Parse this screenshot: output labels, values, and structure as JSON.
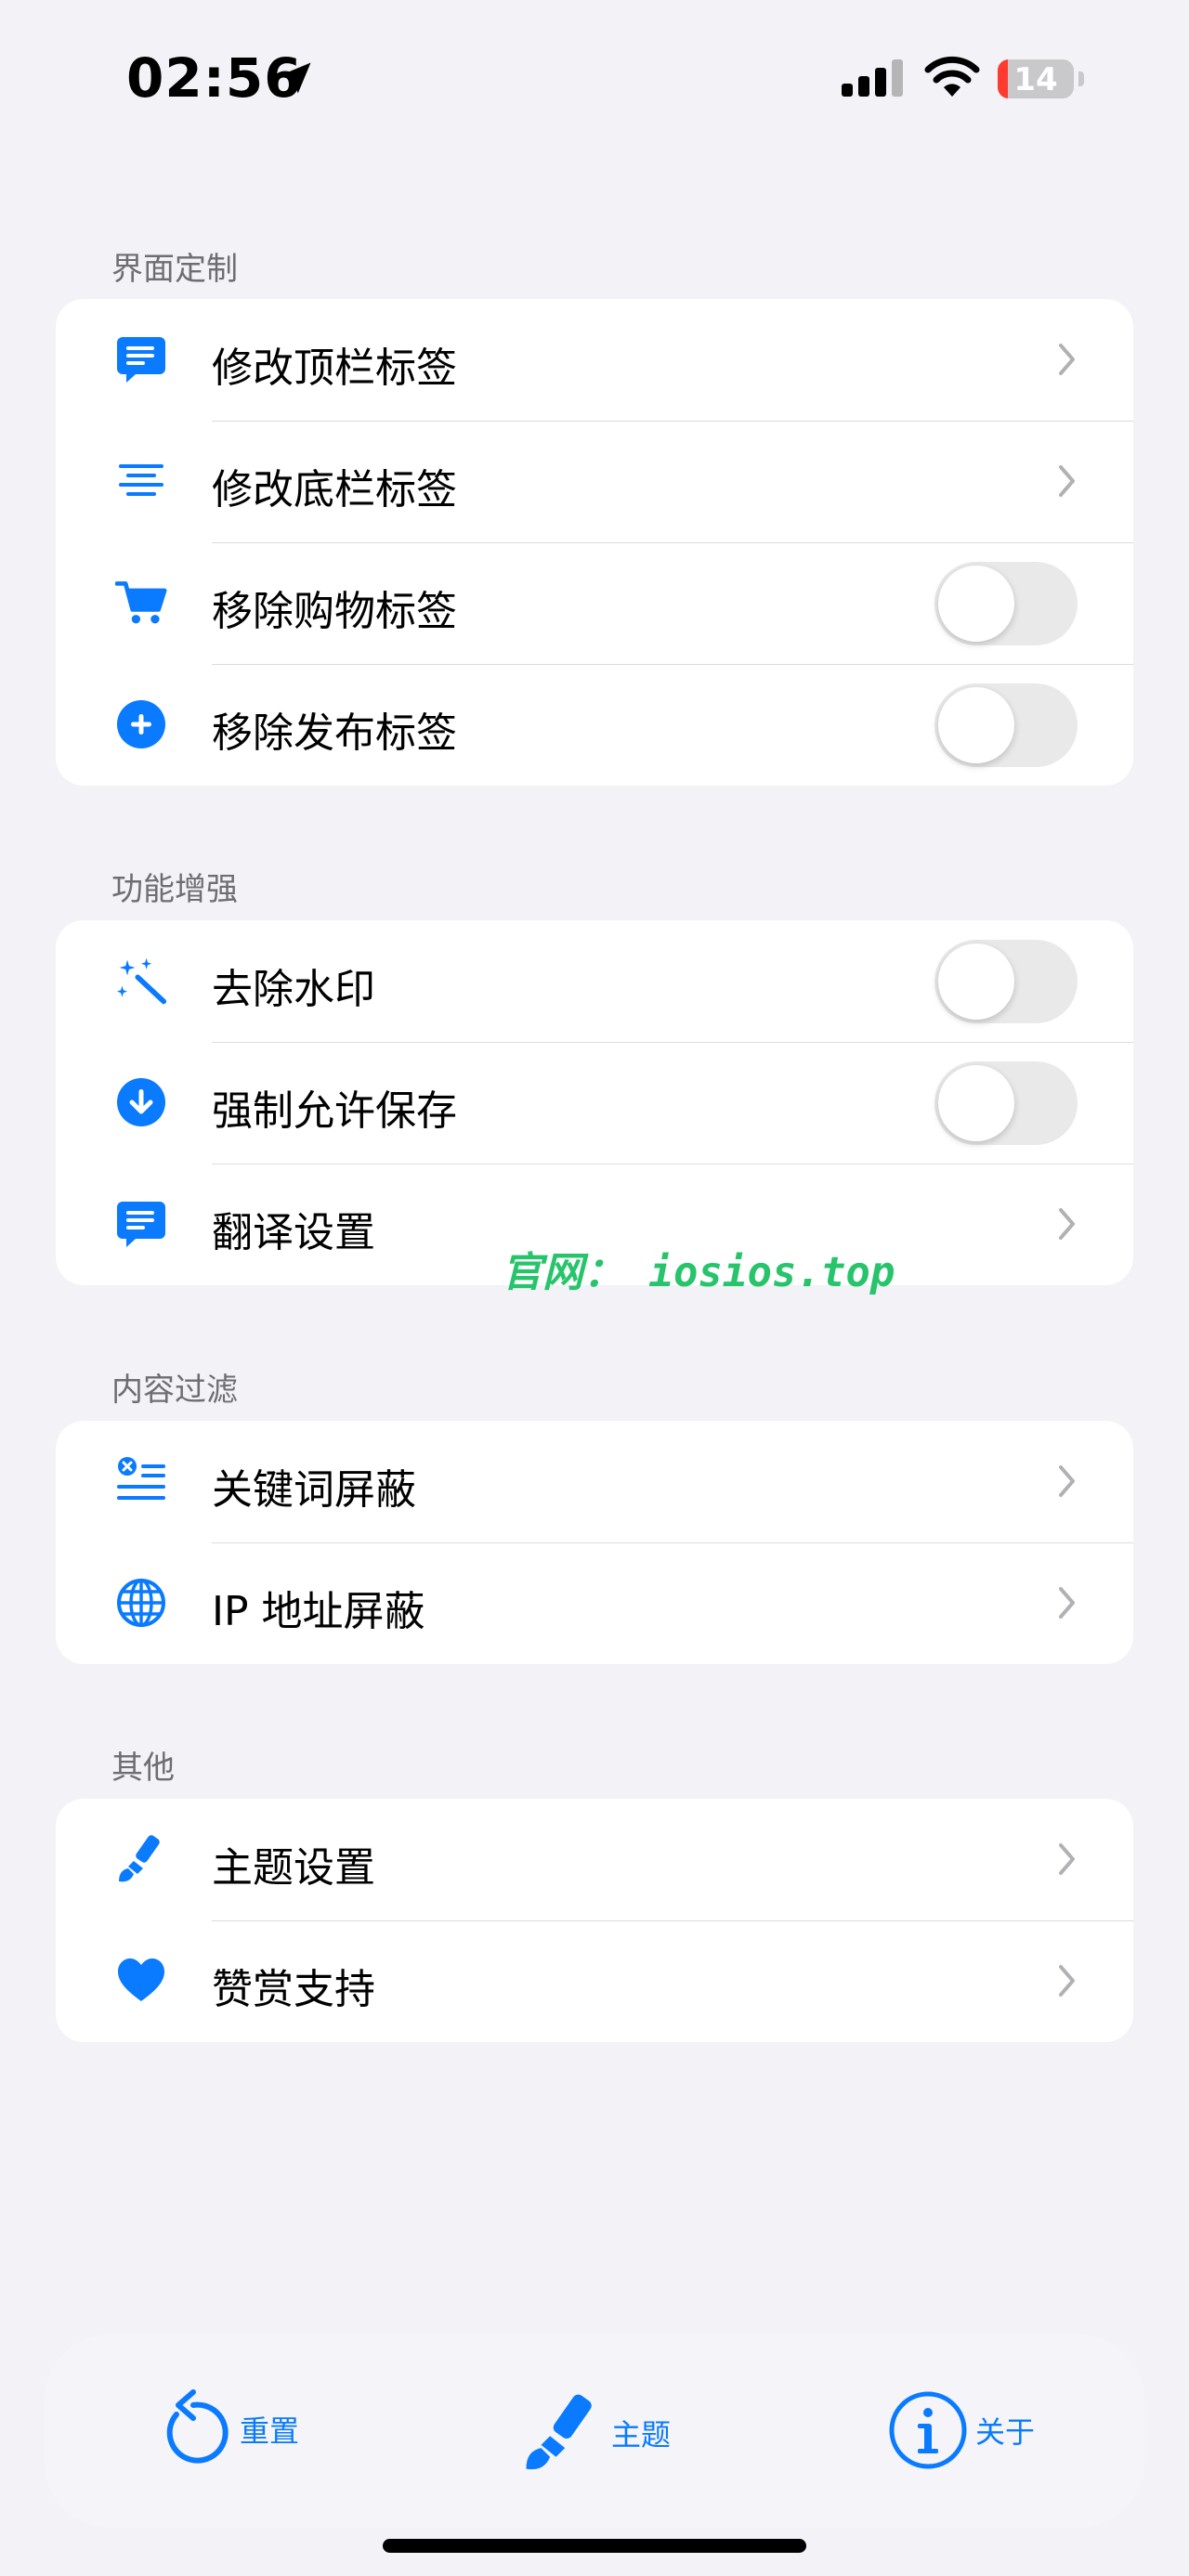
{
  "status_bar": {
    "time": "02:56",
    "battery": "14"
  },
  "sections": {
    "ui_custom": {
      "header": "界面定制",
      "items": [
        {
          "label": "修改顶栏标签",
          "icon": "message-icon",
          "control": "chevron"
        },
        {
          "label": "修改底栏标签",
          "icon": "text-align-icon",
          "control": "chevron"
        },
        {
          "label": "移除购物标签",
          "icon": "cart-icon",
          "control": "toggle",
          "on": false
        },
        {
          "label": "移除发布标签",
          "icon": "plus-circle-icon",
          "control": "toggle",
          "on": false
        }
      ]
    },
    "enhance": {
      "header": "功能增强",
      "items": [
        {
          "label": "去除水印",
          "icon": "magic-wand-icon",
          "control": "toggle",
          "on": false
        },
        {
          "label": "强制允许保存",
          "icon": "download-circle-icon",
          "control": "toggle",
          "on": false
        },
        {
          "label": "翻译设置",
          "icon": "message-icon",
          "control": "chevron"
        }
      ]
    },
    "filter": {
      "header": "内容过滤",
      "items": [
        {
          "label": "关键词屏蔽",
          "icon": "list-block-icon",
          "control": "chevron"
        },
        {
          "label": "IP 地址屏蔽",
          "icon": "globe-icon",
          "control": "chevron"
        }
      ]
    },
    "other": {
      "header": "其他",
      "items": [
        {
          "label": "主题设置",
          "icon": "paintbrush-icon",
          "control": "chevron"
        },
        {
          "label": "赞赏支持",
          "icon": "heart-icon",
          "control": "chevron"
        }
      ]
    }
  },
  "watermark": "官网： iosios.top",
  "bottom_bar": {
    "reset_label": "重置",
    "theme_label": "主题",
    "about_label": "关于"
  },
  "colors": {
    "accent": "#0a7aff",
    "background": "#f2f2f7",
    "watermark": "#27c46b"
  }
}
